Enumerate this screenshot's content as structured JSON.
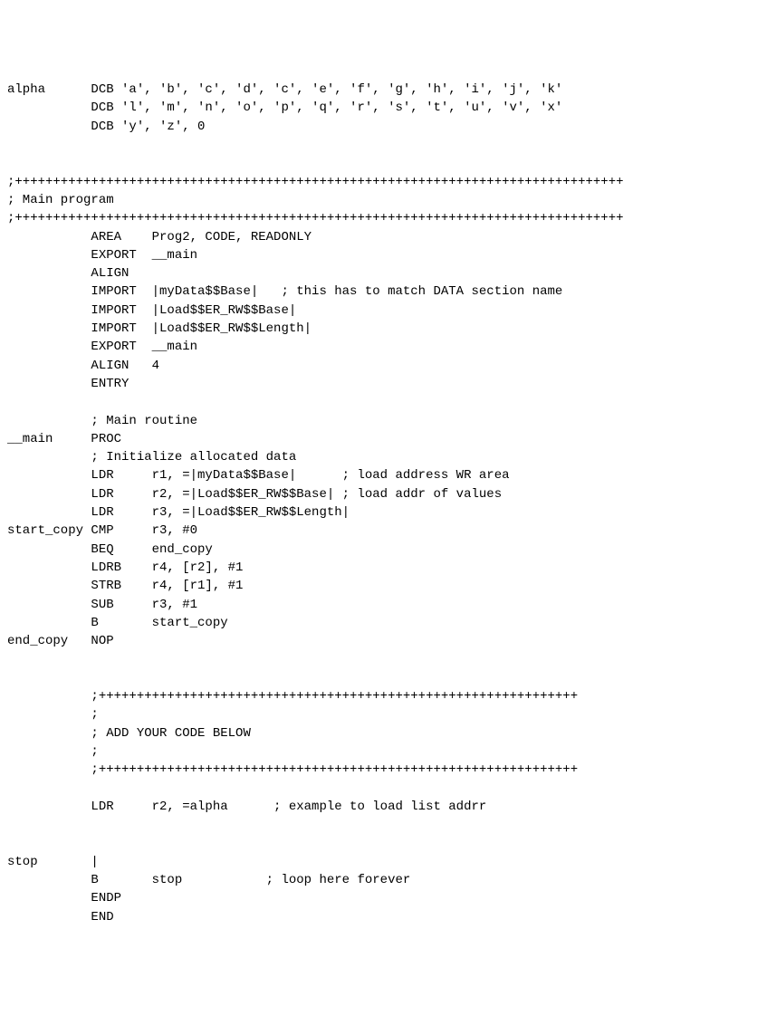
{
  "lines": [
    "alpha      DCB 'a', 'b', 'c', 'd', 'c', 'e', 'f', 'g', 'h', 'i', 'j', 'k'",
    "           DCB 'l', 'm', 'n', 'o', 'p', 'q', 'r', 's', 't', 'u', 'v', 'x'",
    "           DCB 'y', 'z', 0",
    "",
    "",
    ";++++++++++++++++++++++++++++++++++++++++++++++++++++++++++++++++++++++++++++++++",
    "; Main program",
    ";++++++++++++++++++++++++++++++++++++++++++++++++++++++++++++++++++++++++++++++++",
    "           AREA    Prog2, CODE, READONLY",
    "           EXPORT  __main",
    "           ALIGN",
    "           IMPORT  |myData$$Base|   ; this has to match DATA section name",
    "           IMPORT  |Load$$ER_RW$$Base|",
    "           IMPORT  |Load$$ER_RW$$Length|",
    "           EXPORT  __main",
    "           ALIGN   4",
    "           ENTRY",
    "",
    "           ; Main routine",
    "__main     PROC",
    "           ; Initialize allocated data",
    "           LDR     r1, =|myData$$Base|      ; load address WR area",
    "           LDR     r2, =|Load$$ER_RW$$Base| ; load addr of values",
    "           LDR     r3, =|Load$$ER_RW$$Length|",
    "start_copy CMP     r3, #0",
    "           BEQ     end_copy",
    "           LDRB    r4, [r2], #1",
    "           STRB    r4, [r1], #1",
    "           SUB     r3, #1",
    "           B       start_copy",
    "end_copy   NOP",
    "",
    "",
    "           ;+++++++++++++++++++++++++++++++++++++++++++++++++++++++++++++++",
    "           ;",
    "           ; ADD YOUR CODE BELOW",
    "           ;",
    "           ;+++++++++++++++++++++++++++++++++++++++++++++++++++++++++++++++",
    "",
    "           LDR     r2, =alpha      ; example to load list addrr",
    "",
    "",
    "stop       |",
    "           B       stop           ; loop here forever",
    "           ENDP",
    "           END"
  ]
}
